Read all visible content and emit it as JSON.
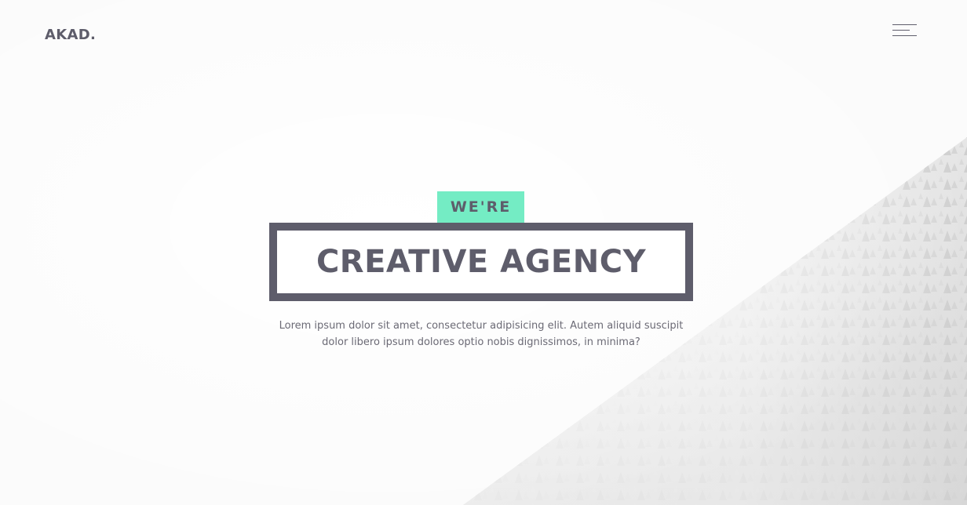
{
  "header": {
    "logo_text": "AKAD.",
    "menu_icon": "hamburger-menu-icon"
  },
  "hero": {
    "tagline": "WE'RE",
    "title": "CREATIVE AGENCY",
    "description": "Lorem ipsum dolor sit amet, consectetur adipisicing elit. Autem aliquid suscipit dolor libero ipsum dolores optio nobis dignissimos, in minima?"
  },
  "colors": {
    "accent": "#74ecc4",
    "text_dark": "#5e5d6b",
    "body_text": "#6b6a75",
    "background": "#fbfbfb"
  }
}
